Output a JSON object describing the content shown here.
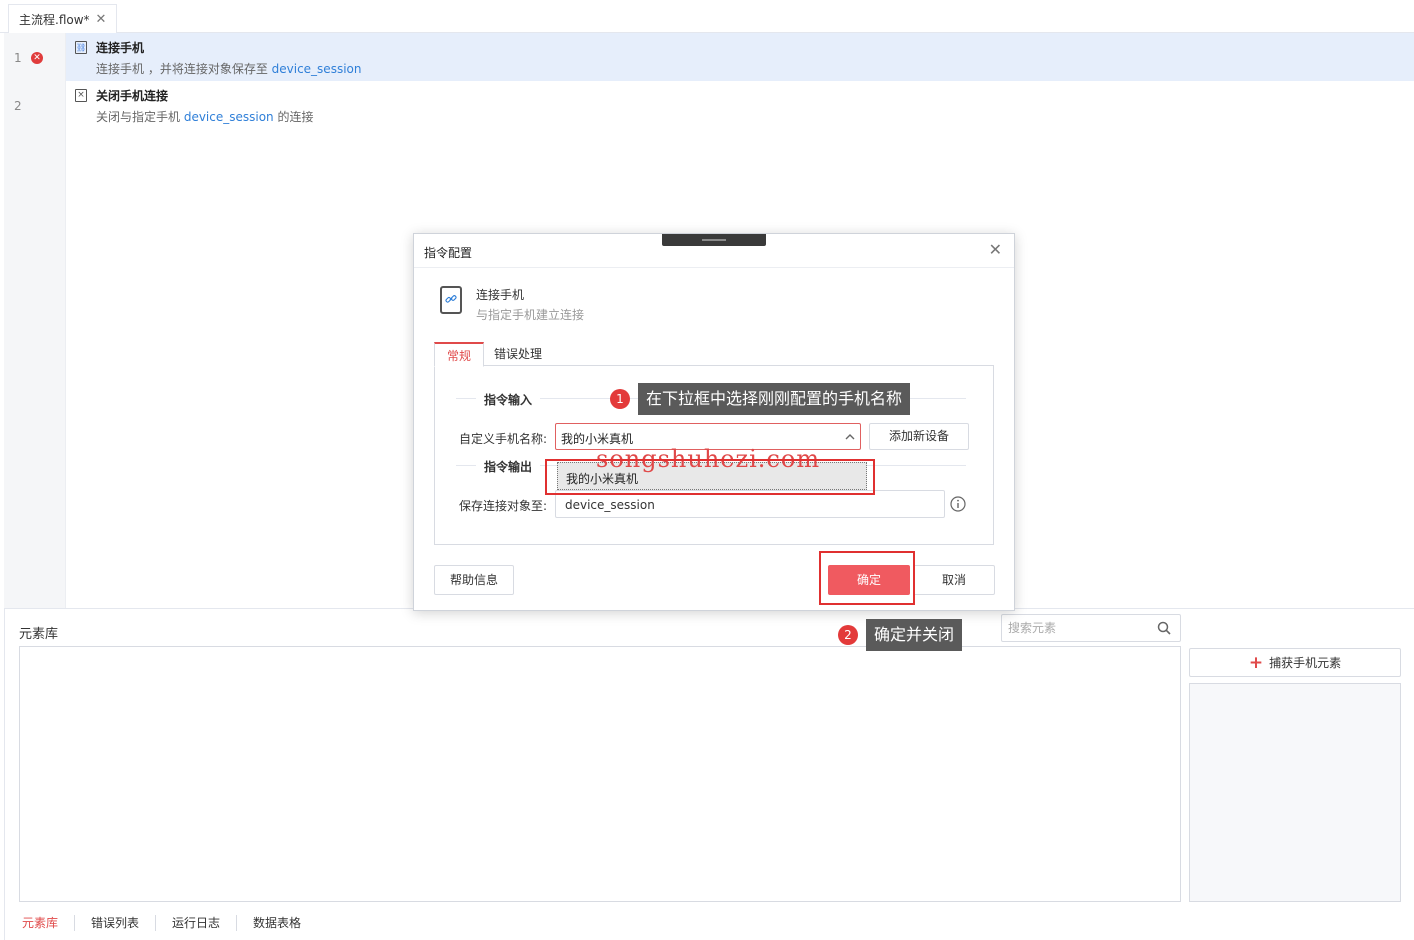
{
  "tab": {
    "title": "主流程.flow*",
    "close": "✕"
  },
  "steps": [
    {
      "line": "1",
      "title": "连接手机",
      "desc_prefix": "连接手机 ，并将连接对象保存至 ",
      "desc_var": "device_session",
      "desc_suffix": "",
      "error": true
    },
    {
      "line": "2",
      "title": "关闭手机连接",
      "desc_prefix": "关闭与指定手机 ",
      "desc_var": "device_session",
      "desc_suffix": " 的连接",
      "error": false
    }
  ],
  "dialog": {
    "title": "指令配置",
    "close": "✕",
    "command_name": "连接手机",
    "command_desc": "与指定手机建立连接",
    "tabs": [
      "常规",
      "错误处理"
    ],
    "section_input": "指令输入",
    "section_output": "指令输出",
    "device_label": "自定义手机名称:",
    "device_value": "我的小米真机",
    "add_device": "添加新设备",
    "dropdown_option": "我的小米真机",
    "save_label": "保存连接对象至:",
    "save_value": "device_session",
    "help": "帮助信息",
    "ok": "确定",
    "cancel": "取消"
  },
  "library": {
    "title": "元素库",
    "search_placeholder": "搜索元素",
    "capture": "捕获手机元素"
  },
  "bottom_tabs": [
    "元素库",
    "错误列表",
    "运行日志",
    "数据表格"
  ],
  "annotations": {
    "step1_num": "1",
    "step1_text": "在下拉框中选择刚刚配置的手机名称",
    "step2_num": "2",
    "step2_text": "确定并关闭",
    "watermark": "songshuhezi.com"
  },
  "colors": {
    "accent": "#e04a4a",
    "primary_btn": "#f05a60",
    "link": "#2f7fd8",
    "selected_row": "#e6eefb"
  }
}
